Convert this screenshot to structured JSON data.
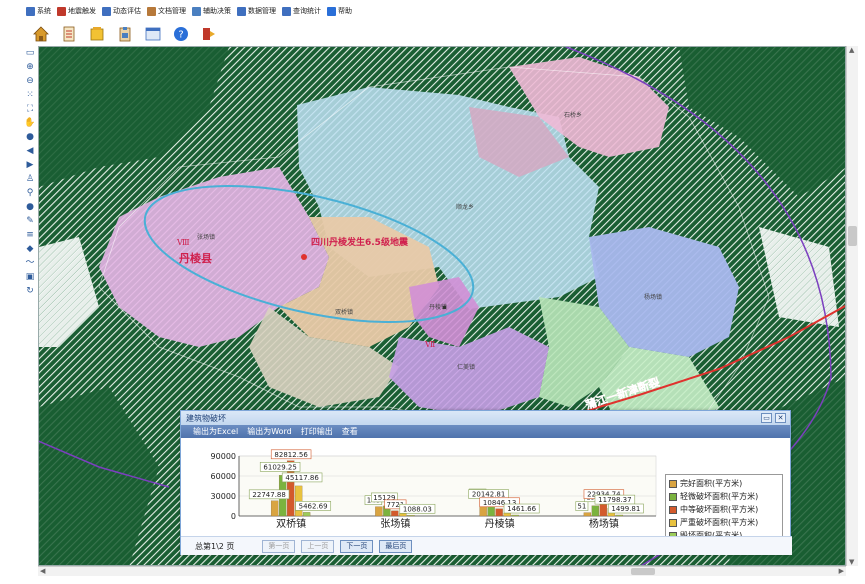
{
  "menubar": {
    "items": [
      {
        "label": "系统",
        "icon": "system-icon",
        "color": "#3f6fbf"
      },
      {
        "label": "地震触发",
        "icon": "trigger-icon",
        "color": "#c0392b"
      },
      {
        "label": "动态评估",
        "icon": "assess-icon",
        "color": "#3f6fbf"
      },
      {
        "label": "文档管理",
        "icon": "doc-icon",
        "color": "#b7793a"
      },
      {
        "label": "辅助决策",
        "icon": "decision-icon",
        "color": "#4a7fc0"
      },
      {
        "label": "数据管理",
        "icon": "data-icon",
        "color": "#3f6fbf"
      },
      {
        "label": "查询统计",
        "icon": "query-icon",
        "color": "#3f6fbf"
      },
      {
        "label": "帮助",
        "icon": "help-icon",
        "color": "#2a6fd8"
      }
    ]
  },
  "toolbar": {
    "icons": [
      "home-icon",
      "document-icon",
      "folder-icon",
      "clipboard-icon",
      "window-icon",
      "help-icon",
      "exit-icon"
    ]
  },
  "map": {
    "labels": {
      "danleng_county": "丹棱县",
      "epicenter": "四川丹棱发生6.5级地震",
      "intensity_a": "Ⅷ",
      "intensity_b": "Ⅶ",
      "fault": "蒲江一新津断裂",
      "town_zhangchang": "张场镇",
      "town_shuangqiao": "双桥镇",
      "town_yangchang": "杨场镇",
      "town_renmei": "仁美镇",
      "town_danling": "丹棱镇",
      "town_shunlong": "顺龙乡",
      "town_shiqiao": "石桥乡"
    },
    "colors": {
      "forest": "#1a5e33",
      "hatch": "#ffffff",
      "fault_line": "#e0322e",
      "ellipse": "#4ab0d6",
      "boundary": "#7b3fbf"
    }
  },
  "popup": {
    "title": "建筑物破坏",
    "menu": [
      "输出为Excel",
      "输出为Word",
      "打印输出",
      "查看"
    ],
    "footer": {
      "page_text": "总第1\\2 页",
      "buttons": [
        "第一页",
        "上一页",
        "下一页",
        "最后页"
      ]
    }
  },
  "chart_data": {
    "type": "bar",
    "categories": [
      "双桥镇",
      "张场镇",
      "丹棱镇",
      "杨场镇"
    ],
    "ylim": [
      0,
      90000
    ],
    "yticks": [
      0,
      30000,
      60000,
      90000
    ],
    "series": [
      {
        "name": "完好面积(平方米)",
        "color": "#d9a441",
        "values": [
          22747.88,
          14000,
          24000,
          5100
        ]
      },
      {
        "name": "轻微破坏面积(平方米)",
        "color": "#7bb33f",
        "values": [
          61029.25,
          15129,
          20142.81,
          15400
        ]
      },
      {
        "name": "中等破坏面积(平方米)",
        "color": "#d35a2c",
        "values": [
          82812.56,
          7721,
          10846.13,
          22934.74
        ]
      },
      {
        "name": "严重破坏面积(平方米)",
        "color": "#e8c23f",
        "values": [
          45117.86,
          3900,
          4200,
          11798.37
        ]
      },
      {
        "name": "毁坏面积(平方米)",
        "color": "#9ccc5a",
        "values": [
          5462.69,
          1088.03,
          1461.66,
          1499.81
        ]
      }
    ],
    "data_labels": [
      [
        "22747.88",
        "61029.25",
        "82812.56",
        "45117.86",
        "5462.69"
      ],
      [
        "140",
        "15129",
        "7721",
        "",
        "1088.03"
      ],
      [
        "240",
        "20142.81",
        "10846.13",
        "",
        "1461.66"
      ],
      [
        "51",
        "154",
        "22934.74",
        "11798.37",
        "1499.81"
      ]
    ]
  }
}
